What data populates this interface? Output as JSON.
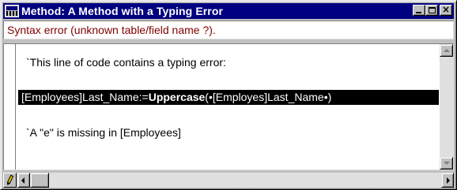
{
  "window": {
    "title": "Method: A Method with a Typing Error",
    "icon": "method-editor-icon",
    "controls": [
      "minimize-icon",
      "maximize-icon",
      "close-icon"
    ],
    "close_glyph": "×"
  },
  "error": {
    "message": "Syntax error (unknown table/field name ?)."
  },
  "code": {
    "lines": [
      {
        "text": "`This line of code contains a typing error:"
      },
      {
        "before": "[Employees]Last_Name:=",
        "command": "Uppercase",
        "after": "(•[Employes]Last_Name•)",
        "selected": true
      },
      {
        "text": "`A \"e\" is missing in [Employees]"
      }
    ]
  },
  "colors": {
    "titlebar": "#000080",
    "error_text": "#800000",
    "selection": "#000000"
  }
}
